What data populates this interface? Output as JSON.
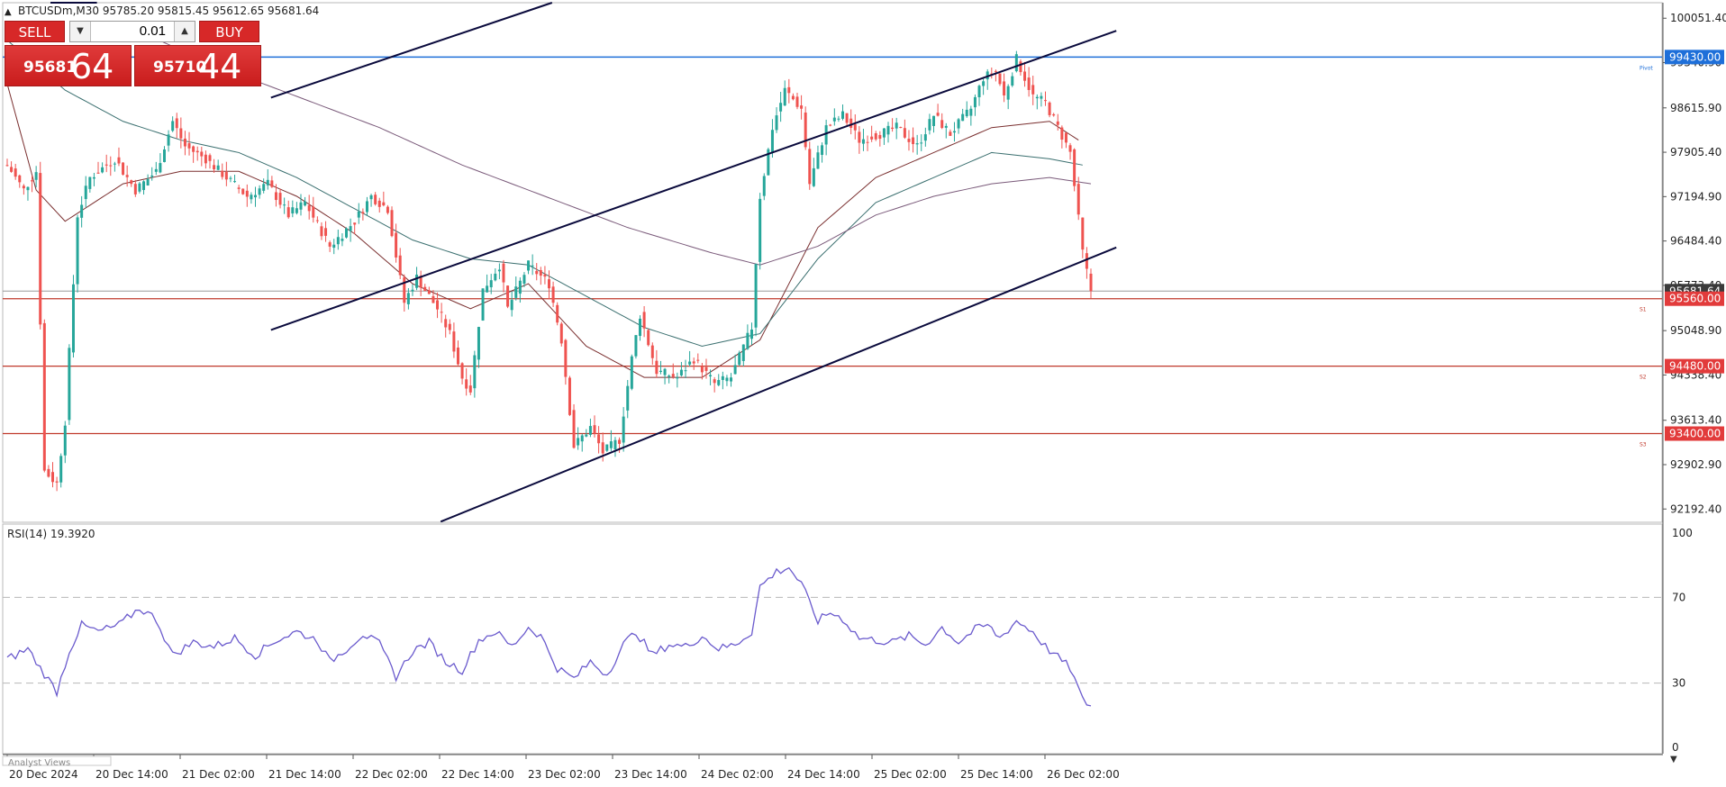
{
  "symbol_header": "BTCUSDm,M30  95785.20 95815.45 95612.65 95681.64",
  "trade_panel": {
    "sell_label": "SELL",
    "buy_label": "BUY",
    "volume": "0.01",
    "sell_price_small": "95681",
    "sell_price_big": "64",
    "buy_price_small": "95710",
    "buy_price_big": "44"
  },
  "indicator_label": "RSI(14) 19.3920",
  "bottom_tab": "Analyst Views",
  "colors": {
    "bull": "#26a69a",
    "bear": "#ef5350",
    "level_line": "#c0392b",
    "pivot_line": "#1e6fd9",
    "rsi_line": "#6a5acd",
    "trend_line": "#0a0a3c",
    "ma_fast": "#7a2f2f",
    "ma_mid": "#3a6f6f",
    "ma_slow": "#7a5a7a"
  },
  "chart_data": {
    "type": "candlestick",
    "symbol": "BTCUSDm",
    "timeframe": "M30",
    "ohlc_readout": {
      "open": 95785.2,
      "high": 95815.45,
      "low": 95612.65,
      "close": 95681.64
    },
    "price_axis": {
      "range": [
        91980,
        100300
      ],
      "ticks": [
        100051.4,
        99340.9,
        98615.9,
        97905.4,
        97194.9,
        96484.4,
        95773.4,
        95048.9,
        94338.4,
        93613.4,
        92902.9,
        92192.4
      ]
    },
    "price_tags": [
      {
        "price": 99430.0,
        "label": "99430.00",
        "color": "#1e6fd9"
      },
      {
        "price": 95681.64,
        "label": "95681.64",
        "color": "#3a3a3a"
      },
      {
        "price": 95560.0,
        "label": "95560.00",
        "color": "#e23b3b"
      },
      {
        "price": 94480.0,
        "label": "94480.00",
        "color": "#e23b3b"
      },
      {
        "price": 93400.0,
        "label": "93400.00",
        "color": "#e23b3b"
      }
    ],
    "levels": [
      {
        "name": "Pivot",
        "price": 99430.0,
        "color": "#1e6fd9"
      },
      {
        "name": "S1",
        "price": 95560.0,
        "color": "#c0392b"
      },
      {
        "name": "S2",
        "price": 94480.0,
        "color": "#c0392b"
      },
      {
        "name": "S3",
        "price": 93400.0,
        "color": "#c0392b"
      }
    ],
    "time_axis": [
      "20 Dec 2024",
      "20 Dec 14:00",
      "21 Dec 02:00",
      "21 Dec 14:00",
      "22 Dec 02:00",
      "22 Dec 14:00",
      "23 Dec 02:00",
      "23 Dec 14:00",
      "24 Dec 02:00",
      "24 Dec 14:00",
      "25 Dec 02:00",
      "25 Dec 14:00",
      "26 Dec 02:00"
    ],
    "trend_lines": [
      {
        "from": [
          "20 Dec 2024 +4.0",
          100300
        ],
        "to": [
          "20 Dec 2024 +8.3",
          100300
        ]
      },
      {
        "from": [
          "21 Dec 14:00 +0.4",
          98780
        ],
        "to": [
          "23 Dec 02:00 +2.4",
          100300
        ]
      },
      {
        "from": [
          "21 Dec 14:00 +0.4",
          95060
        ],
        "to": [
          "26 Dec 02:00 +6.6",
          99850
        ]
      },
      {
        "from": [
          "22 Dec 14:00 +0.1",
          91990
        ],
        "to": [
          "26 Dec 02:00 +6.6",
          96380
        ]
      }
    ],
    "price_path": [
      [
        0,
        97700
      ],
      [
        4,
        97300
      ],
      [
        7,
        97600
      ],
      [
        9,
        92800
      ],
      [
        12,
        92600
      ],
      [
        14,
        93600
      ],
      [
        17,
        96900
      ],
      [
        20,
        97500
      ],
      [
        26,
        97800
      ],
      [
        31,
        97300
      ],
      [
        36,
        97600
      ],
      [
        40,
        98400
      ],
      [
        43,
        98000
      ],
      [
        48,
        97800
      ],
      [
        53,
        97500
      ],
      [
        58,
        97200
      ],
      [
        63,
        97400
      ],
      [
        68,
        96900
      ],
      [
        72,
        97100
      ],
      [
        78,
        96400
      ],
      [
        84,
        96800
      ],
      [
        88,
        97200
      ],
      [
        92,
        97000
      ],
      [
        96,
        95500
      ],
      [
        99,
        95900
      ],
      [
        104,
        95400
      ],
      [
        107,
        95000
      ],
      [
        110,
        94300
      ],
      [
        112,
        94100
      ],
      [
        115,
        95700
      ],
      [
        119,
        96100
      ],
      [
        121,
        95400
      ],
      [
        126,
        96100
      ],
      [
        131,
        95800
      ],
      [
        134,
        94900
      ],
      [
        137,
        93200
      ],
      [
        141,
        93500
      ],
      [
        144,
        93100
      ],
      [
        148,
        93300
      ],
      [
        151,
        94600
      ],
      [
        153,
        95300
      ],
      [
        157,
        94400
      ],
      [
        162,
        94300
      ],
      [
        166,
        94600
      ],
      [
        171,
        94200
      ],
      [
        175,
        94300
      ],
      [
        180,
        95100
      ],
      [
        182,
        97200
      ],
      [
        185,
        98300
      ],
      [
        188,
        98900
      ],
      [
        192,
        98600
      ],
      [
        194,
        97400
      ],
      [
        198,
        98300
      ],
      [
        202,
        98500
      ],
      [
        206,
        98100
      ],
      [
        211,
        98200
      ],
      [
        215,
        98300
      ],
      [
        220,
        98000
      ],
      [
        224,
        98500
      ],
      [
        228,
        98200
      ],
      [
        233,
        98600
      ],
      [
        236,
        99100
      ],
      [
        239,
        99200
      ],
      [
        241,
        98800
      ],
      [
        244,
        99400
      ],
      [
        248,
        98800
      ],
      [
        251,
        98700
      ],
      [
        254,
        98300
      ],
      [
        257,
        97900
      ],
      [
        260,
        96300
      ],
      [
        262,
        95681.64
      ]
    ],
    "moving_averages": [
      {
        "name": "MA fast",
        "path": [
          [
            0,
            99000
          ],
          [
            7,
            97300
          ],
          [
            14,
            96800
          ],
          [
            28,
            97400
          ],
          [
            42,
            97600
          ],
          [
            56,
            97600
          ],
          [
            70,
            97200
          ],
          [
            84,
            96600
          ],
          [
            98,
            95800
          ],
          [
            112,
            95400
          ],
          [
            126,
            95800
          ],
          [
            140,
            94800
          ],
          [
            154,
            94300
          ],
          [
            168,
            94300
          ],
          [
            182,
            94900
          ],
          [
            196,
            96700
          ],
          [
            210,
            97500
          ],
          [
            224,
            97900
          ],
          [
            238,
            98300
          ],
          [
            252,
            98400
          ],
          [
            259,
            98100
          ]
        ]
      },
      {
        "name": "MA mid",
        "path": [
          [
            0,
            99700
          ],
          [
            14,
            98900
          ],
          [
            28,
            98400
          ],
          [
            42,
            98100
          ],
          [
            56,
            97900
          ],
          [
            70,
            97500
          ],
          [
            84,
            97000
          ],
          [
            98,
            96500
          ],
          [
            112,
            96200
          ],
          [
            126,
            96100
          ],
          [
            140,
            95600
          ],
          [
            154,
            95100
          ],
          [
            168,
            94800
          ],
          [
            182,
            95000
          ],
          [
            196,
            96200
          ],
          [
            210,
            97100
          ],
          [
            224,
            97500
          ],
          [
            238,
            97900
          ],
          [
            252,
            97800
          ],
          [
            260,
            97700
          ]
        ]
      },
      {
        "name": "MA slow",
        "path": [
          [
            30,
            99900
          ],
          [
            50,
            99300
          ],
          [
            70,
            98800
          ],
          [
            90,
            98300
          ],
          [
            110,
            97700
          ],
          [
            130,
            97200
          ],
          [
            150,
            96700
          ],
          [
            170,
            96300
          ],
          [
            182,
            96100
          ],
          [
            196,
            96400
          ],
          [
            210,
            96900
          ],
          [
            224,
            97200
          ],
          [
            238,
            97400
          ],
          [
            252,
            97500
          ],
          [
            262,
            97400
          ]
        ]
      }
    ],
    "rsi": {
      "label": "RSI(14)",
      "value": 19.392,
      "range": [
        0,
        100
      ],
      "ticks": [
        100,
        70,
        30,
        0
      ],
      "levels": [
        70,
        30
      ],
      "path": [
        [
          0,
          41
        ],
        [
          5,
          46
        ],
        [
          8,
          37
        ],
        [
          12,
          26
        ],
        [
          15,
          45
        ],
        [
          18,
          57
        ],
        [
          22,
          54
        ],
        [
          27,
          57
        ],
        [
          32,
          65
        ],
        [
          36,
          60
        ],
        [
          40,
          43
        ],
        [
          45,
          49
        ],
        [
          50,
          47
        ],
        [
          55,
          51
        ],
        [
          60,
          43
        ],
        [
          65,
          50
        ],
        [
          70,
          54
        ],
        [
          75,
          50
        ],
        [
          78,
          40
        ],
        [
          82,
          46
        ],
        [
          86,
          53
        ],
        [
          90,
          48
        ],
        [
          94,
          33
        ],
        [
          98,
          45
        ],
        [
          102,
          49
        ],
        [
          106,
          40
        ],
        [
          110,
          36
        ],
        [
          114,
          50
        ],
        [
          118,
          54
        ],
        [
          122,
          47
        ],
        [
          126,
          56
        ],
        [
          129,
          52
        ],
        [
          133,
          37
        ],
        [
          137,
          32
        ],
        [
          141,
          40
        ],
        [
          145,
          34
        ],
        [
          149,
          48
        ],
        [
          152,
          54
        ],
        [
          156,
          43
        ],
        [
          160,
          48
        ],
        [
          164,
          47
        ],
        [
          168,
          52
        ],
        [
          172,
          46
        ],
        [
          176,
          48
        ],
        [
          180,
          54
        ],
        [
          182,
          75
        ],
        [
          186,
          82
        ],
        [
          189,
          84
        ],
        [
          192,
          76
        ],
        [
          196,
          59
        ],
        [
          199,
          63
        ],
        [
          202,
          60
        ],
        [
          206,
          51
        ],
        [
          210,
          50
        ],
        [
          214,
          49
        ],
        [
          218,
          52
        ],
        [
          222,
          48
        ],
        [
          226,
          56
        ],
        [
          230,
          49
        ],
        [
          234,
          55
        ],
        [
          237,
          57
        ],
        [
          240,
          51
        ],
        [
          244,
          59
        ],
        [
          248,
          54
        ],
        [
          251,
          47
        ],
        [
          254,
          42
        ],
        [
          257,
          37
        ],
        [
          260,
          22
        ],
        [
          262,
          19.392
        ]
      ]
    }
  }
}
